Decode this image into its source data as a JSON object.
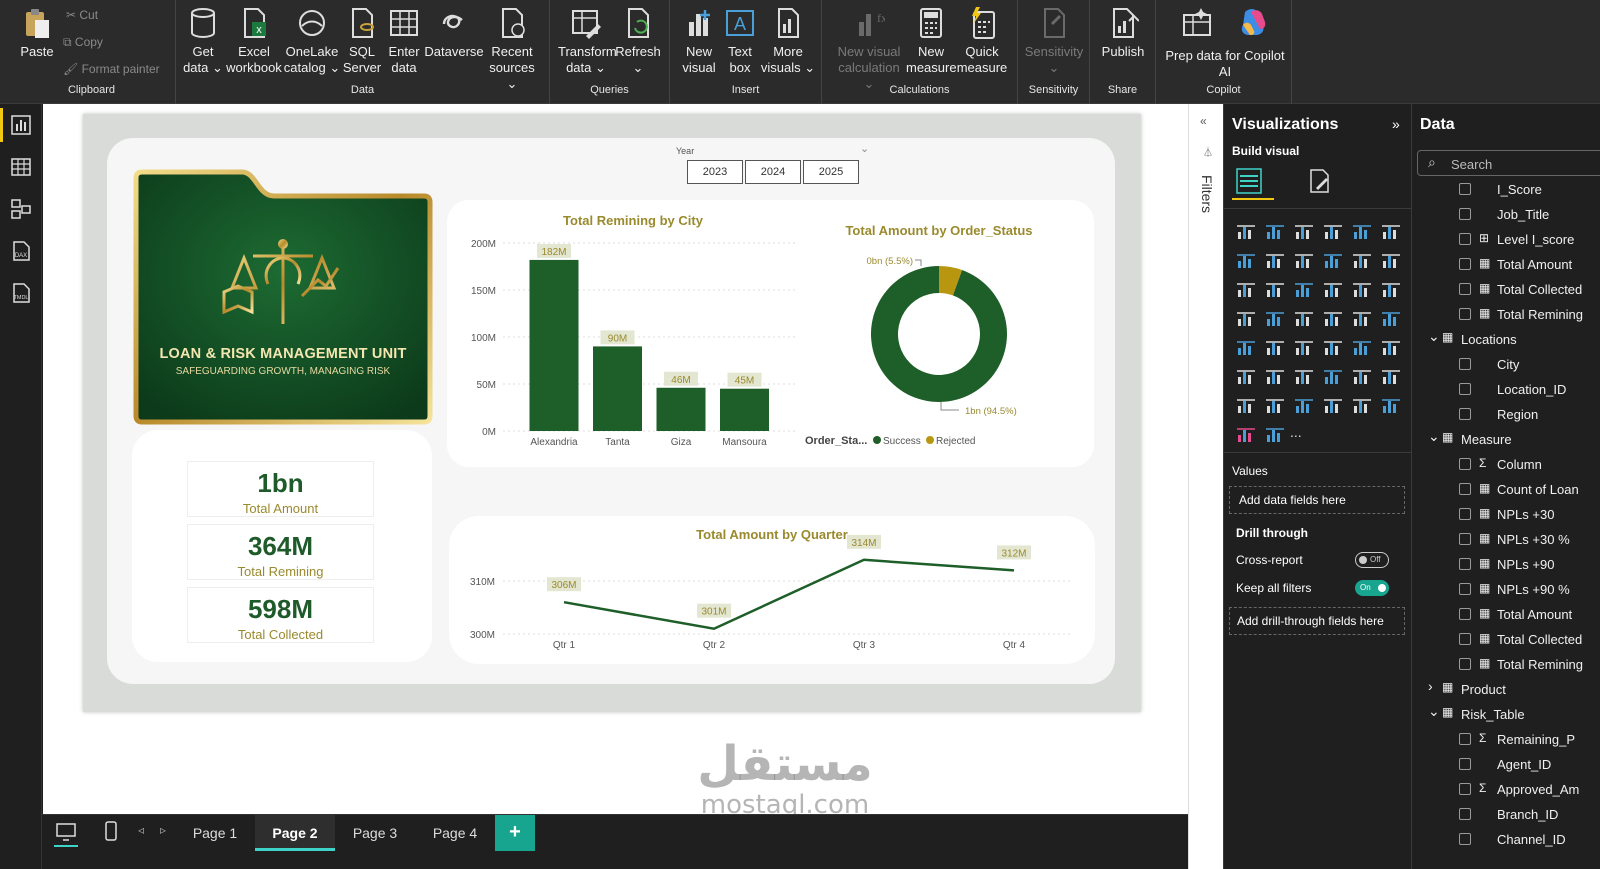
{
  "ribbon": {
    "clipboard": {
      "paste": "Paste",
      "cut": "Cut",
      "copy": "Copy",
      "format_painter": "Format painter",
      "label": "Clipboard"
    },
    "data": {
      "get_data": "Get data",
      "excel": "Excel workbook",
      "onelake": "OneLake catalog",
      "sql": "SQL Server",
      "enter": "Enter data",
      "dataverse": "Dataverse",
      "recent": "Recent sources",
      "label": "Data"
    },
    "queries": {
      "transform": "Transform data",
      "refresh": "Refresh",
      "label": "Queries"
    },
    "insert": {
      "new_visual": "New visual",
      "text_box": "Text box",
      "more_visuals": "More visuals",
      "label": "Insert"
    },
    "calculations": {
      "new_visual_calc": "New visual calculation",
      "new_measure": "New measure",
      "quick_measure": "Quick measure",
      "label": "Calculations"
    },
    "sensitivity": {
      "btn": "Sensitivity",
      "label": "Sensitivity"
    },
    "share": {
      "publish": "Publish",
      "label": "Share"
    },
    "copilot": {
      "prep": "Prep data for Copilot AI",
      "label": "Copilot"
    }
  },
  "report": {
    "slicer": {
      "title": "Year",
      "options": [
        "2023",
        "2024",
        "2025"
      ]
    },
    "logo": {
      "title": "LOAN & RISK MANAGEMENT UNIT",
      "subtitle": "SAFEGUARDING GROWTH, MANAGING RISK"
    },
    "kpis": [
      {
        "value": "1bn",
        "label": "Total Amount"
      },
      {
        "value": "364M",
        "label": "Total Remining"
      },
      {
        "value": "598M",
        "label": "Total Collected"
      }
    ]
  },
  "chart_data": [
    {
      "type": "bar",
      "title": "Total Remining by City",
      "categories": [
        "Alexandria",
        "Tanta",
        "Giza",
        "Mansoura"
      ],
      "values": [
        182,
        90,
        46,
        45
      ],
      "data_labels": [
        "182M",
        "90M",
        "46M",
        "45M"
      ],
      "yticks": [
        "200M",
        "150M",
        "100M",
        "50M",
        "0M"
      ],
      "ylim": [
        0,
        200
      ]
    },
    {
      "type": "pie",
      "title": "Total Amount by Order_Status",
      "legend_title": "Order_Sta...",
      "labels": [
        "Success",
        "Rejected"
      ],
      "values": [
        94.5,
        5.5
      ],
      "data_labels": [
        "1bn (94.5%)",
        "0bn (5.5%)"
      ],
      "colors": [
        "#1e5e28",
        "#b8960f"
      ]
    },
    {
      "type": "line",
      "title": "Total Amount by Quarter",
      "categories": [
        "Qtr 1",
        "Qtr 2",
        "Qtr 3",
        "Qtr 4"
      ],
      "values": [
        306,
        301,
        314,
        312
      ],
      "data_labels": [
        "306M",
        "301M",
        "314M",
        "312M"
      ],
      "yticks": [
        "310M",
        "300M"
      ],
      "ylim": [
        300,
        316
      ]
    }
  ],
  "pages": {
    "tabs": [
      "Page 1",
      "Page 2",
      "Page 3",
      "Page 4"
    ],
    "active": "Page 2",
    "add": "+"
  },
  "filters": {
    "label": "Filters"
  },
  "visualizations": {
    "title": "Visualizations",
    "build": "Build visual",
    "values_label": "Values",
    "values_placeholder": "Add data fields here",
    "drill": "Drill through",
    "cross": "Cross-report",
    "cross_state": "Off",
    "keep": "Keep all filters",
    "keep_state": "On",
    "drill_placeholder": "Add drill-through fields here",
    "more": "..."
  },
  "data_pane": {
    "title": "Data",
    "search": "Search",
    "rows": [
      {
        "text": "I_Score",
        "kind": "field"
      },
      {
        "text": "Job_Title",
        "kind": "field"
      },
      {
        "text": "Level I_score",
        "kind": "calc"
      },
      {
        "text": "Total Amount",
        "kind": "measure"
      },
      {
        "text": "Total Collected",
        "kind": "measure"
      },
      {
        "text": "Total Remining",
        "kind": "measure"
      },
      {
        "text": "Locations",
        "kind": "table-open"
      },
      {
        "text": "City",
        "kind": "field"
      },
      {
        "text": "Location_ID",
        "kind": "field"
      },
      {
        "text": "Region",
        "kind": "field"
      },
      {
        "text": "Measure",
        "kind": "table-open"
      },
      {
        "text": "Column",
        "kind": "sum"
      },
      {
        "text": "Count of Loan",
        "kind": "measure"
      },
      {
        "text": "NPLs +30",
        "kind": "measure"
      },
      {
        "text": "NPLs +30 %",
        "kind": "measure"
      },
      {
        "text": "NPLs +90",
        "kind": "measure"
      },
      {
        "text": "NPLs +90 %",
        "kind": "measure"
      },
      {
        "text": "Total Amount",
        "kind": "measure"
      },
      {
        "text": "Total Collected",
        "kind": "measure"
      },
      {
        "text": "Total Remining",
        "kind": "measure"
      },
      {
        "text": "Product",
        "kind": "table-closed"
      },
      {
        "text": "Risk_Table",
        "kind": "table-open"
      },
      {
        "text": "Remaining_P",
        "kind": "sum"
      },
      {
        "text": "Agent_ID",
        "kind": "field"
      },
      {
        "text": "Approved_Am",
        "kind": "sum"
      },
      {
        "text": "Branch_ID",
        "kind": "field"
      },
      {
        "text": "Channel_ID",
        "kind": "field"
      }
    ]
  },
  "watermark": {
    "arabic": "مستقل",
    "latin": "mostaql.com"
  },
  "colors": {
    "green": "#1e5e28",
    "gold": "#b8960f",
    "label_gold": "#9a8a2e",
    "label_bg": "#e3e6d0"
  }
}
